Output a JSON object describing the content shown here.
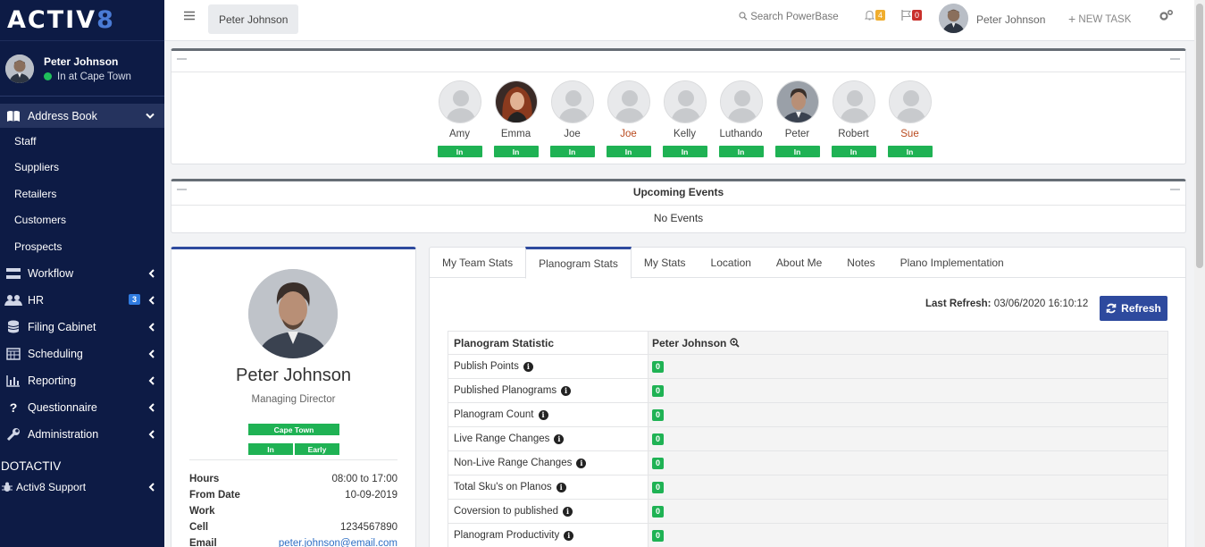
{
  "brand": {
    "logo_main": "ACTIV",
    "logo_num": "8"
  },
  "sidebar": {
    "user_name": "Peter Johnson",
    "user_status": "In at Cape Town",
    "address_book": "Address Book",
    "sub_items": [
      "Staff",
      "Suppliers",
      "Retailers",
      "Customers",
      "Prospects"
    ],
    "items": [
      {
        "label": "Workflow",
        "icon": "sitemap-icon"
      },
      {
        "label": "HR",
        "icon": "users-icon",
        "badge": "3"
      },
      {
        "label": "Filing Cabinet",
        "icon": "database-icon"
      },
      {
        "label": "Scheduling",
        "icon": "calendar-icon"
      },
      {
        "label": "Reporting",
        "icon": "bar-chart-icon"
      },
      {
        "label": "Questionnaire",
        "icon": "question-icon"
      },
      {
        "label": "Administration",
        "icon": "wrench-icon"
      }
    ],
    "section": "DOTACTIV",
    "support": "Activ8 Support"
  },
  "topbar": {
    "breadcrumb": "Peter Johnson",
    "search_placeholder": "Search PowerBase",
    "notifications": "4",
    "flags": "0",
    "user_name": "Peter Johnson",
    "new_task": "NEW TASK"
  },
  "team": [
    {
      "name": "Amy",
      "status": "In",
      "photo": false,
      "red": false
    },
    {
      "name": "Emma",
      "status": "In",
      "photo": true,
      "red": false
    },
    {
      "name": "Joe",
      "status": "In",
      "photo": false,
      "red": false
    },
    {
      "name": "Joe",
      "status": "In",
      "photo": false,
      "red": true
    },
    {
      "name": "Kelly",
      "status": "In",
      "photo": false,
      "red": false
    },
    {
      "name": "Luthando",
      "status": "In",
      "photo": false,
      "red": false
    },
    {
      "name": "Peter",
      "status": "In",
      "photo": true,
      "red": false
    },
    {
      "name": "Robert",
      "status": "In",
      "photo": false,
      "red": false
    },
    {
      "name": "Sue",
      "status": "In",
      "photo": false,
      "red": true
    }
  ],
  "events": {
    "title": "Upcoming Events",
    "empty": "No Events"
  },
  "profile": {
    "name": "Peter Johnson",
    "title": "Managing Director",
    "location": "Cape Town",
    "status": "In",
    "timing": "Early",
    "rows": [
      {
        "k": "Hours",
        "v": "08:00 to 17:00"
      },
      {
        "k": "From Date",
        "v": "10-09-2019"
      },
      {
        "k": "Work",
        "v": ""
      },
      {
        "k": "Cell",
        "v": "1234567890"
      },
      {
        "k": "Email",
        "v": "peter.johnson@email.com"
      }
    ]
  },
  "stats": {
    "tabs": [
      "My Team Stats",
      "Planogram Stats",
      "My Stats",
      "Location",
      "About Me",
      "Notes",
      "Plano Implementation"
    ],
    "active_tab": 1,
    "last_refresh_label": "Last Refresh:",
    "last_refresh_value": "03/06/2020 16:10:12",
    "refresh_button": "Refresh",
    "col1_header": "Planogram Statistic",
    "col2_header": "Peter Johnson",
    "rows": [
      {
        "label": "Publish Points",
        "value": "0"
      },
      {
        "label": "Published Planograms",
        "value": "0"
      },
      {
        "label": "Planogram Count",
        "value": "0"
      },
      {
        "label": "Live Range Changes",
        "value": "0"
      },
      {
        "label": "Non-Live Range Changes",
        "value": "0"
      },
      {
        "label": "Total Sku's on Planos",
        "value": "0"
      },
      {
        "label": "Coversion to published",
        "value": "0"
      },
      {
        "label": "Planogram Productivity",
        "value": "0"
      }
    ]
  },
  "colors": {
    "sidebar": "#0d1b45",
    "accent": "#2e4a9e",
    "status_green": "#1fb254"
  }
}
